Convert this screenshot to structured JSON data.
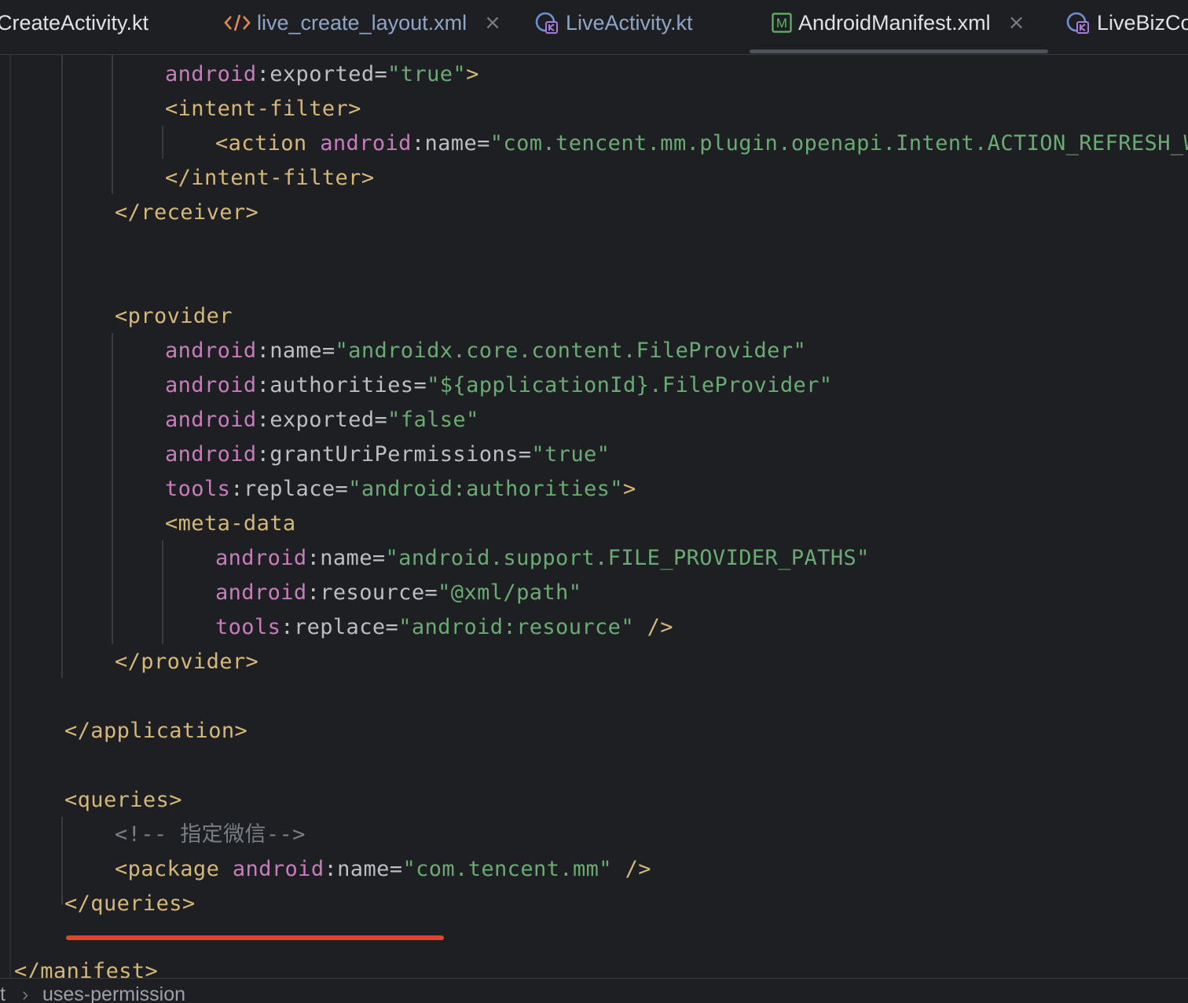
{
  "tabs": [
    {
      "label": "CreateActivity.kt",
      "icon": "none",
      "active": false,
      "closable": false
    },
    {
      "label": "live_create_layout.xml",
      "icon": "xml-code-icon",
      "active": false,
      "closable": true
    },
    {
      "label": "LiveActivity.kt",
      "icon": "kotlin-class-icon",
      "active": false,
      "closable": false
    },
    {
      "label": "AndroidManifest.xml",
      "icon": "manifest-icon",
      "active": true,
      "closable": true
    },
    {
      "label": "LiveBizCo",
      "icon": "kotlin-class-icon",
      "active": false,
      "closable": false
    }
  ],
  "tab_close_glyph": "×",
  "manifest_icon_letter": "M",
  "code": {
    "l1": {
      "ns": "android",
      "attr": "exported",
      "val": "\"true\"",
      "end": ">"
    },
    "l2": {
      "tag": "<intent-filter>"
    },
    "l3": {
      "tag": "<action",
      "ns": "android",
      "attr": "name",
      "val": "\"com.tencent.mm.plugin.openapi.Intent.ACTION_REFRESH_WXAP"
    },
    "l4": {
      "tag": "</intent-filter>"
    },
    "l5": {
      "tag": "</receiver>"
    },
    "l6": {
      "tag": "<provider"
    },
    "l7": {
      "ns": "android",
      "attr": "name",
      "val": "\"androidx.core.content.FileProvider\""
    },
    "l8": {
      "ns": "android",
      "attr": "authorities",
      "val": "\"${applicationId}.FileProvider\""
    },
    "l9": {
      "ns": "android",
      "attr": "exported",
      "val": "\"false\""
    },
    "l10": {
      "ns": "android",
      "attr": "grantUriPermissions",
      "val": "\"true\""
    },
    "l11": {
      "ns": "tools",
      "attr": "replace",
      "val": "\"android:authorities\"",
      "end": ">"
    },
    "l12": {
      "tag": "<meta-data"
    },
    "l13": {
      "ns": "android",
      "attr": "name",
      "val": "\"android.support.FILE_PROVIDER_PATHS\""
    },
    "l14": {
      "ns": "android",
      "attr": "resource",
      "val": "\"@xml/path\""
    },
    "l15": {
      "ns": "tools",
      "attr": "replace",
      "val": "\"android:resource\"",
      "end": " />"
    },
    "l16": {
      "tag": "</provider>"
    },
    "l17": {
      "tag": "</application>"
    },
    "l18": {
      "tag": "<queries>"
    },
    "l19": {
      "comment": "<!-- 指定微信-->"
    },
    "l20": {
      "tag": "<package",
      "ns": "android",
      "attr": "name",
      "val": "\"com.tencent.mm\"",
      "end": " />"
    },
    "l21": {
      "tag": "</queries>"
    },
    "l22": {
      "tag": "</manifest>"
    }
  },
  "colon": ":",
  "equals": "=",
  "breadcrumb": {
    "root": "t",
    "separator": "›",
    "item": "uses-permission"
  }
}
